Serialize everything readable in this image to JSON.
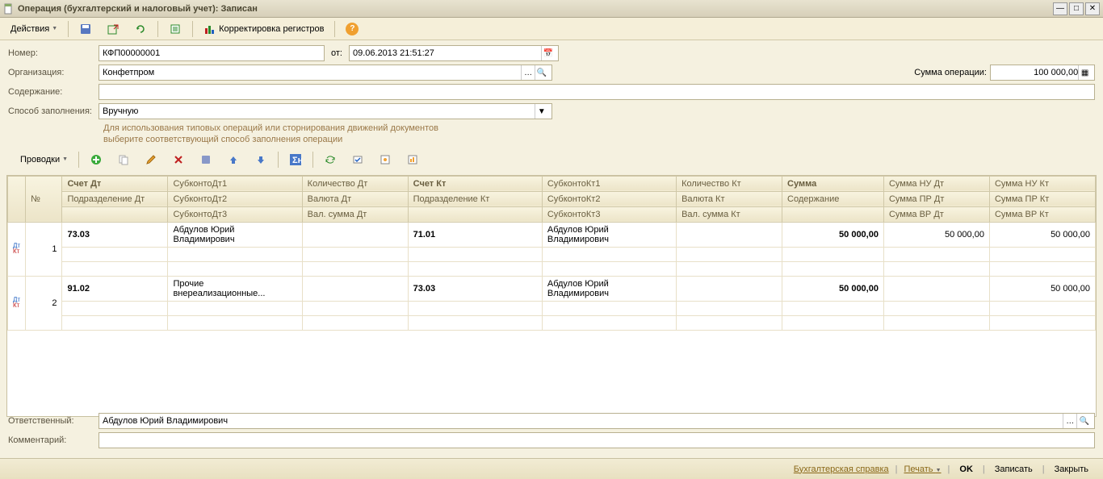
{
  "window": {
    "title": "Операция (бухгалтерский и налоговый учет): Записан"
  },
  "toolbar": {
    "actions": "Действия",
    "registers": "Корректировка регистров"
  },
  "form": {
    "number_label": "Номер:",
    "number_value": "КФП00000001",
    "from_label": "от:",
    "date_value": "09.06.2013 21:51:27",
    "org_label": "Организация:",
    "org_value": "Конфетпром",
    "content_label": "Содержание:",
    "content_value": "",
    "fill_label": "Способ заполнения:",
    "fill_value": "Вручную",
    "hint1": "Для использования типовых операций или сторнирования движений документов",
    "hint2": "выберите соответствующий способ заполнения операции",
    "sum_label": "Сумма операции:",
    "sum_value": "100 000,00"
  },
  "entries": {
    "label": "Проводки",
    "headers": {
      "num": "№",
      "acc_dt": "Счет Дт",
      "div_dt": "Подразделение Дт",
      "sub_dt1": "СубконтоДт1",
      "sub_dt2": "СубконтоДт2",
      "sub_dt3": "СубконтоДт3",
      "qty_dt": "Количество Дт",
      "cur_dt": "Валюта Дт",
      "cursum_dt": "Вал. сумма Дт",
      "acc_kt": "Счет Кт",
      "div_kt": "Подразделение Кт",
      "sub_kt1": "СубконтоКт1",
      "sub_kt2": "СубконтоКт2",
      "sub_kt3": "СубконтоКт3",
      "qty_kt": "Количество Кт",
      "cur_kt": "Валюта Кт",
      "cursum_kt": "Вал. сумма Кт",
      "sum": "Сумма",
      "content": "Содержание",
      "nu_dt": "Сумма НУ Дт",
      "pr_dt": "Сумма ПР Дт",
      "vr_dt": "Сумма ВР Дт",
      "nu_kt": "Сумма НУ Кт",
      "pr_kt": "Сумма ПР Кт",
      "vr_kt": "Сумма ВР Кт"
    },
    "rows": [
      {
        "num": "1",
        "acc_dt": "73.03",
        "sub_dt1": "Абдулов Юрий Владимирович",
        "acc_kt": "71.01",
        "sub_kt1": "Абдулов Юрий Владимирович",
        "sum": "50 000,00",
        "nu_dt": "50 000,00",
        "nu_kt": "50 000,00"
      },
      {
        "num": "2",
        "acc_dt": "91.02",
        "sub_dt1": "Прочие внереализационные...",
        "acc_kt": "73.03",
        "sub_kt1": "Абдулов Юрий Владимирович",
        "sum": "50 000,00",
        "nu_dt": "",
        "nu_kt": "50 000,00"
      }
    ]
  },
  "bottom": {
    "resp_label": "Ответственный:",
    "resp_value": "Абдулов Юрий Владимирович",
    "comment_label": "Комментарий:",
    "comment_value": ""
  },
  "footer": {
    "report": "Бухгалтерская справка",
    "print": "Печать",
    "ok": "OK",
    "save": "Записать",
    "close": "Закрыть"
  }
}
